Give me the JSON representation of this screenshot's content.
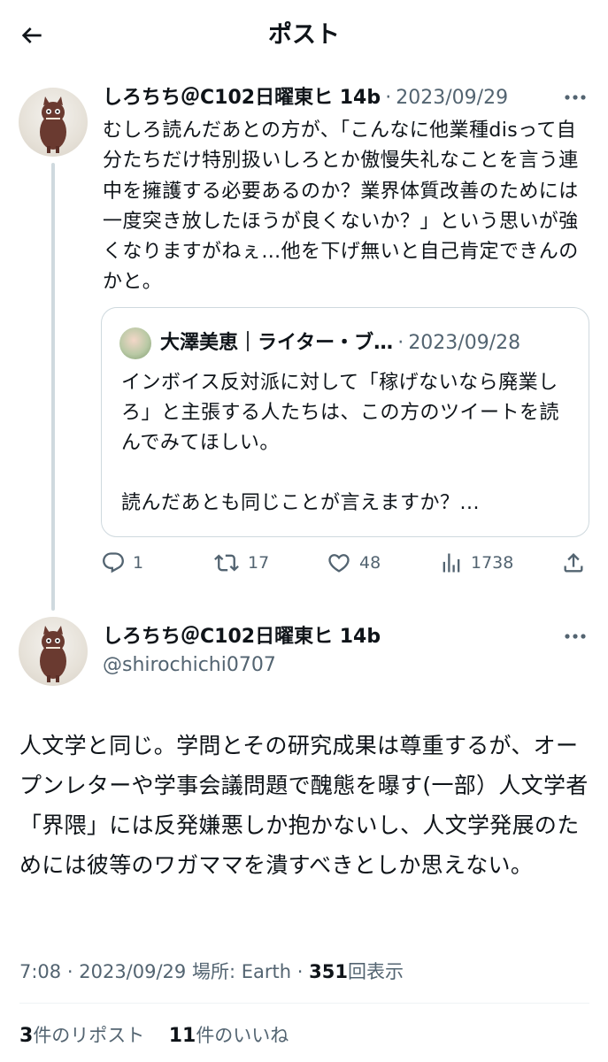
{
  "header": {
    "title": "ポスト"
  },
  "tweet1": {
    "display_name": "しろちち＠C102日曜東ヒ 14b",
    "separator": "·",
    "date": "2023/09/29",
    "text": "むしろ読んだあとの方が、「こんなに他業種disって自分たちだけ特別扱いしろとか傲慢失礼なことを言う連中を擁護する必要あるのか？業界体質改善のためには一度突き放したほうが良くないか？」という思いが強くなりますがねぇ…他を下げ無いと自己肯定できんのかと。",
    "quote": {
      "display_name": "大澤美恵｜ライター・ブ…",
      "separator": "·",
      "date": "2023/09/28",
      "text_1": "インボイス反対派に対して「稼げないなら廃業しろ」と主張する人たちは、この方のツイートを読んでみてほしい。",
      "text_2": "読んだあとも同じことが言えますか？..."
    },
    "actions": {
      "replies": "1",
      "reposts": "17",
      "likes": "48",
      "views": "1738"
    }
  },
  "tweet2": {
    "display_name": "しろちち＠C102日曜東ヒ 14b",
    "handle": "@shirochichi0707",
    "text": "人文学と同じ。学問とその研究成果は尊重するが、オープンレターや学事会議問題で醜態を曝す(一部）人文学者「界隈」には反発嫌悪しか抱かないし、人文学発展のためには彼等のワガママを潰すべきとしか思えない。",
    "meta": {
      "time": "7:08",
      "sep1": "·",
      "date": "2023/09/29",
      "location_label": "場所:",
      "location": "Earth",
      "sep2": "·",
      "views": "351",
      "views_label": "回表示"
    },
    "stats": {
      "reposts": "3",
      "reposts_label": "件のリポスト",
      "likes": "11",
      "likes_label": "件のいいね"
    }
  },
  "colors": {
    "text": "#0f1419",
    "secondary": "#536471",
    "border": "#cfd9de"
  },
  "icons": [
    "back-arrow-icon",
    "more-icon",
    "reply-icon",
    "repost-icon",
    "like-icon",
    "views-icon",
    "share-icon"
  ]
}
